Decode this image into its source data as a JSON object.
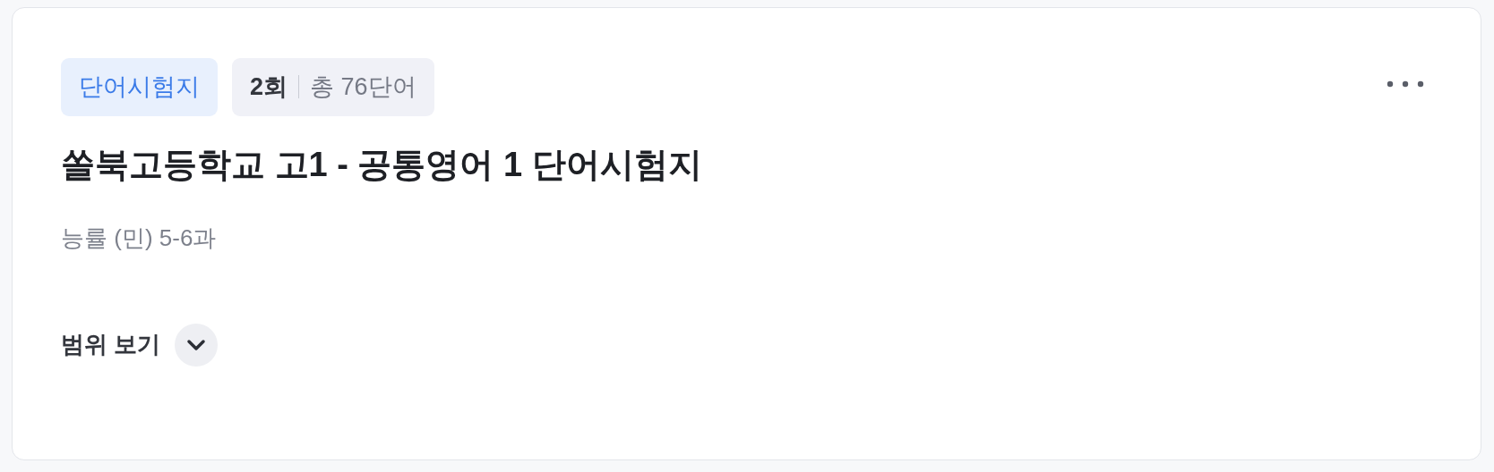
{
  "tag": "단어시험지",
  "round": "2회",
  "word_count": "총 76단어",
  "title": "쏠북고등학교 고1 - 공통영어 1 단어시험지",
  "subtitle": "능률 (민) 5-6과",
  "range_toggle": {
    "label": "범위 보기",
    "expanded": false
  }
}
